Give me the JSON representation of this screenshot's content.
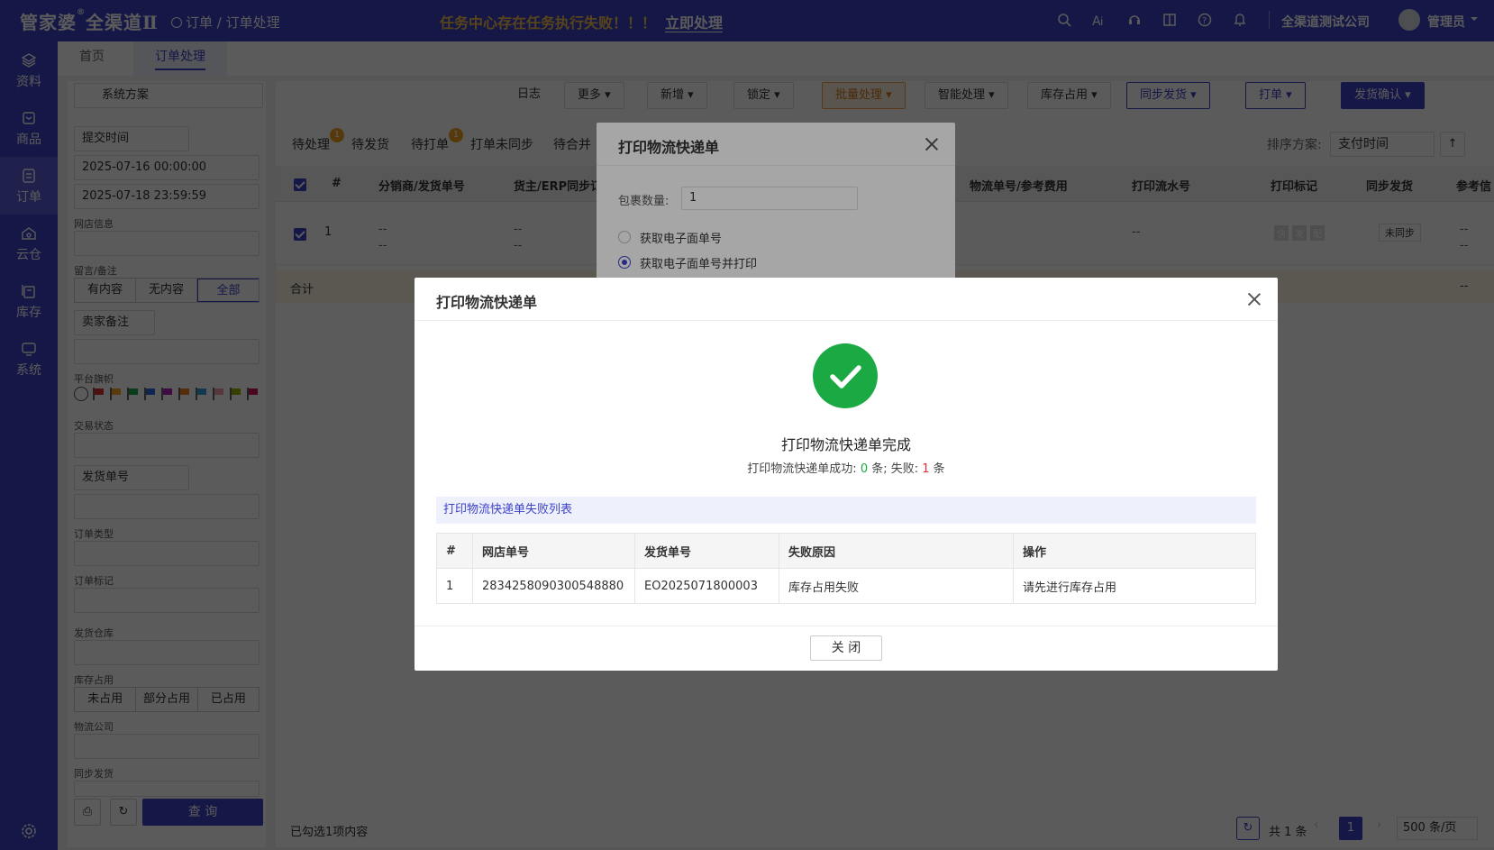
{
  "topbar": {
    "brand": "管家婆",
    "brand_sub": "全渠道Ⅱ",
    "breadcrumb": [
      "订单",
      "订单处理"
    ],
    "alert_text": "任务中心存在任务执行失败！！！",
    "alert_action": "立即处理",
    "company": "全渠道测试公司",
    "user": "管理员",
    "icons": [
      "search-icon",
      "ai-icon",
      "headset-icon",
      "book-icon",
      "help-icon",
      "bell-icon"
    ]
  },
  "sidebar": {
    "items": [
      {
        "label": "资料",
        "icon": "layers-icon"
      },
      {
        "label": "商品",
        "icon": "box-icon"
      },
      {
        "label": "订单",
        "icon": "document-icon"
      },
      {
        "label": "云仓",
        "icon": "cloud-warehouse-icon"
      },
      {
        "label": "库存",
        "icon": "stock-icon"
      },
      {
        "label": "系统",
        "icon": "monitor-icon"
      }
    ],
    "active_index": 2
  },
  "tabs": [
    "首页",
    "订单处理"
  ],
  "filter": {
    "scheme": "系统方案",
    "time_type": "提交时间",
    "date_from": "2025-07-16 00:00:00",
    "date_to": "2025-07-18 23:59:59",
    "shop_label": "网店信息",
    "memo_label": "留言/备注",
    "memo_options": [
      "有内容",
      "无内容",
      "全部"
    ],
    "seller_note": "卖家备注",
    "flag_label": "平台旗帜",
    "trade_label": "交易状态",
    "ship_no": "发货单号",
    "order_type": "订单类型",
    "order_mark": "订单标记",
    "warehouse": "发货仓库",
    "stock_label": "库存占用",
    "stock_options": [
      "未占用",
      "部分占用",
      "已占用"
    ],
    "logistics": "物流公司",
    "sync_label": "同步发货",
    "query": "查 询"
  },
  "toolbar": {
    "log": "日志",
    "more": "更多",
    "add": "新增",
    "lock": "锁定",
    "batch": "批量处理",
    "smart": "智能处理",
    "stock": "库存占用",
    "sync": "同步发货",
    "print": "打单",
    "confirm": "发货确认"
  },
  "subtabs": [
    {
      "label": "待处理",
      "badge": "1"
    },
    {
      "label": "待发货",
      "badge": ""
    },
    {
      "label": "待打单",
      "badge": "1"
    },
    {
      "label": "打单未同步",
      "badge": ""
    },
    {
      "label": "待合并",
      "badge": ""
    }
  ],
  "sort": {
    "label": "排序方案:",
    "value": "支付时间"
  },
  "grid": {
    "columns": [
      "#",
      "分销商/发货单号",
      "货主/ERP同步订",
      "物流单号/参考费用",
      "打印流水号",
      "打印标记",
      "同步发货",
      "参考信"
    ],
    "row": {
      "index": "1",
      "c1a": "--",
      "c1b": "--",
      "c2a": "--",
      "c2b": "--",
      "serial": "--",
      "marks": [
        "快",
        "发",
        "配"
      ],
      "sync": "未同步",
      "ref_a": "--",
      "ref_b": "--"
    },
    "sum_label": "合计",
    "sum_value": "--"
  },
  "footer": {
    "selected": "已勾选1项内容",
    "total": "共 1 条",
    "page": "1",
    "page_size": "500 条/页"
  },
  "dialog_back": {
    "title": "打印物流快递单",
    "qty_label": "包裹数量:",
    "qty": "1",
    "opt1": "获取电子面单号",
    "opt2": "获取电子面单号并打印"
  },
  "dialog_front": {
    "title": "打印物流快递单",
    "heading": "打印物流快递单完成",
    "stat_prefix": "打印物流快递单成功: ",
    "success": "0",
    "stat_mid": " 条; 失败: ",
    "fail": "1",
    "stat_suffix": " 条",
    "fail_list": "打印物流快递单失败列表",
    "columns": [
      "#",
      "网店单号",
      "发货单号",
      "失败原因",
      "操作"
    ],
    "rows": [
      [
        "1",
        "2834258090300548880",
        "EO2025071800003",
        "库存占用失败",
        "请先进行库存占用"
      ]
    ],
    "close": "关 闭",
    "colors": {
      "success": "#1ba944",
      "fail": "#e23030"
    }
  }
}
